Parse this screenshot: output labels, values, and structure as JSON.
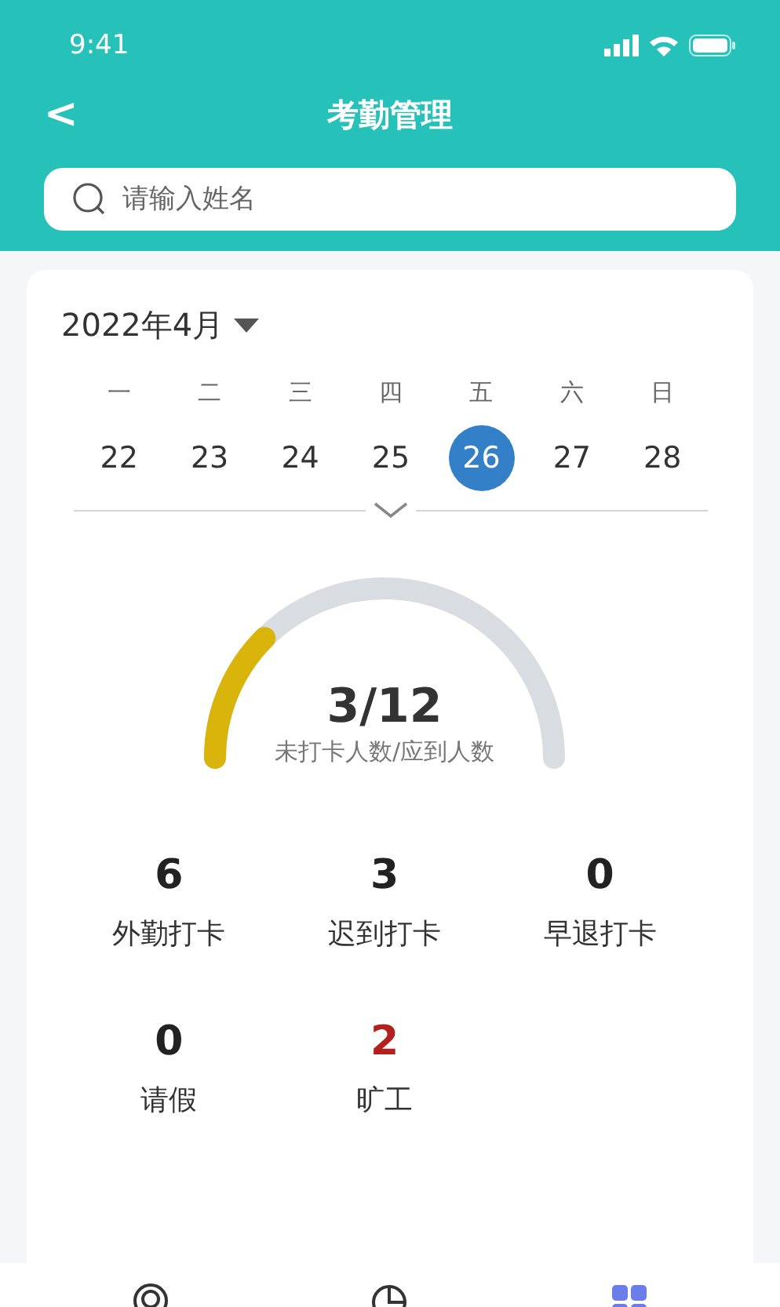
{
  "status_bar": {
    "time": "9:41"
  },
  "header": {
    "back": "<",
    "title": "考勤管理"
  },
  "search": {
    "placeholder": "请输入姓名"
  },
  "calendar": {
    "month": "2022年4月",
    "weekdays": [
      "一",
      "二",
      "三",
      "四",
      "五",
      "六",
      "日"
    ],
    "days": [
      {
        "label": "22",
        "selected": false
      },
      {
        "label": "23",
        "selected": false
      },
      {
        "label": "24",
        "selected": false
      },
      {
        "label": "25",
        "selected": false
      },
      {
        "label": "26",
        "selected": true
      },
      {
        "label": "27",
        "selected": false
      },
      {
        "label": "28",
        "selected": false
      }
    ]
  },
  "gauge": {
    "value": "3/12",
    "caption": "未打卡人数/应到人数"
  },
  "stats": [
    {
      "value": "6",
      "label": "外勤打卡",
      "color": "#222222"
    },
    {
      "value": "3",
      "label": "迟到打卡",
      "color": "#222222"
    },
    {
      "value": "0",
      "label": "早退打卡",
      "color": "#222222"
    },
    {
      "value": "0",
      "label": "请假",
      "color": "#222222"
    },
    {
      "value": "2",
      "label": "旷工",
      "color": "#b3201e"
    }
  ],
  "bottom_nav": [
    {
      "kind": "location",
      "selected": false
    },
    {
      "kind": "chart",
      "selected": false
    },
    {
      "kind": "grid",
      "selected": true
    }
  ]
}
